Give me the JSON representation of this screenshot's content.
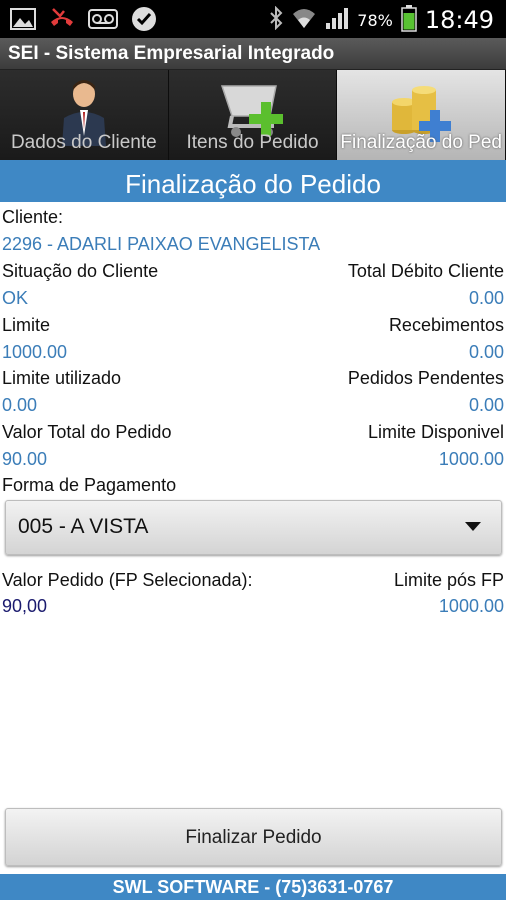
{
  "status_bar": {
    "battery": "78%",
    "time": "18:49",
    "icons": [
      "gallery-icon",
      "missed-call-icon",
      "voicemail-icon",
      "check-icon",
      "bluetooth-icon",
      "wifi-icon",
      "signal-icon",
      "battery-icon"
    ]
  },
  "app": {
    "title": "SEI - Sistema Empresarial Integrado"
  },
  "tabs": [
    {
      "label": "Dados do Cliente",
      "icon": "businessman-icon",
      "active": false
    },
    {
      "label": "Itens do Pedido",
      "icon": "cart-add-icon",
      "active": false
    },
    {
      "label": "Finalização do Ped",
      "icon": "coins-add-icon",
      "active": true
    }
  ],
  "header": {
    "title": "Finalização do Pedido"
  },
  "form": {
    "cliente_label": "Cliente:",
    "cliente_value": "2296 - ADARLI PAIXAO EVANGELISTA",
    "situacao_label": "Situação do Cliente",
    "situacao_value": "OK",
    "total_debito_label": "Total Débito Cliente",
    "total_debito_value": "0.00",
    "limite_label": "Limite",
    "limite_value": "1000.00",
    "recebimentos_label": "Recebimentos",
    "recebimentos_value": "0.00",
    "limite_utilizado_label": "Limite utilizado",
    "limite_utilizado_value": "0.00",
    "pedidos_pendentes_label": "Pedidos Pendentes",
    "pedidos_pendentes_value": "0.00",
    "valor_total_label": "Valor Total do Pedido",
    "valor_total_value": "90.00",
    "limite_disponivel_label": "Limite Disponivel",
    "limite_disponivel_value": "1000.00",
    "forma_pagamento_label": "Forma de Pagamento",
    "forma_pagamento_selected": "005 - A VISTA",
    "valor_pedido_fp_label": "Valor Pedido (FP Selecionada):",
    "valor_pedido_fp_value": "90,00",
    "limite_pos_fp_label": "Limite pós FP",
    "limite_pos_fp_value": "1000.00"
  },
  "actions": {
    "finalize_label": "Finalizar Pedido"
  },
  "footer": {
    "text": "SWL SOFTWARE - (75)3631-0767"
  },
  "colors": {
    "accent": "#3f88c5",
    "value_text": "#3b7db8"
  }
}
